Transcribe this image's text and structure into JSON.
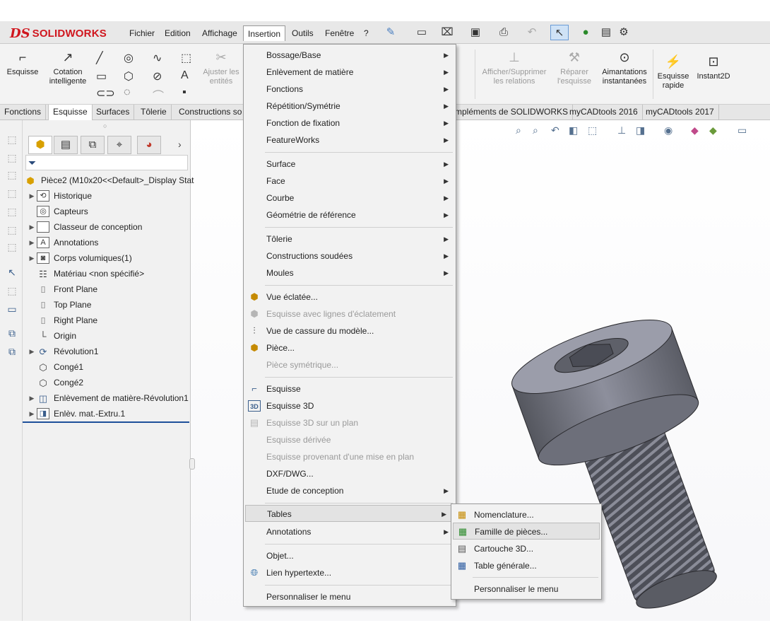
{
  "app": {
    "logo_prefix": "DS",
    "logo_text": "SOLIDWORKS"
  },
  "menubar": {
    "items": [
      "Fichier",
      "Edition",
      "Affichage",
      "Insertion",
      "Outils",
      "Fenêtre",
      "?"
    ]
  },
  "ribbon": {
    "esquisse": "Esquisse",
    "cotation": "Cotation intelligente",
    "ajuster": "Ajuster les entités",
    "afficher_relations": "Afficher/Supprimer les relations",
    "reparer": "Réparer l'esquisse",
    "aimantations": "Aimantations instantanées",
    "esquisse_rapide": "Esquisse rapide",
    "instant2d": "Instant2D"
  },
  "tabs": [
    "Fonctions",
    "Esquisse",
    "Surfaces",
    "Tôlerie",
    "Constructions so",
    "mpléments de SOLIDWORKS",
    "myCADtools 2016",
    "myCADtools 2017"
  ],
  "tree": {
    "root": "Pièce2  (M10x20<<Default>_Display Stat",
    "items": [
      "Historique",
      "Capteurs",
      "Classeur de conception",
      "Annotations",
      "Corps volumiques(1)",
      "Matériau <non spécifié>",
      "Front Plane",
      "Top Plane",
      "Right Plane",
      "Origin",
      "Révolution1",
      "Congé1",
      "Congé2",
      "Enlèvement de matière-Révolution1",
      "Enlèv. mat.-Extru.1"
    ]
  },
  "insert_menu": {
    "items": [
      "Bossage/Base",
      "Enlèvement de matière",
      "Fonctions",
      "Répétition/Symétrie",
      "Fonction de fixation",
      "FeatureWorks",
      "Surface",
      "Face",
      "Courbe",
      "Géométrie de référence",
      "Tôlerie",
      "Constructions soudées",
      "Moules",
      "Vue éclatée...",
      "Esquisse avec lignes d'éclatement",
      "Vue de cassure du modèle...",
      "Pièce...",
      "Pièce symétrique...",
      "Esquisse",
      "Esquisse 3D",
      "Esquisse 3D sur un plan",
      "Esquisse dérivée",
      "Esquisse provenant d'une mise en plan",
      "DXF/DWG...",
      "Etude de conception",
      "Tables",
      "Annotations",
      "Objet...",
      "Lien hypertexte...",
      "Personnaliser le menu"
    ]
  },
  "tables_submenu": {
    "items": [
      "Nomenclature...",
      "Famille de pièces...",
      "Cartouche 3D...",
      "Table générale...",
      "Personnaliser le menu"
    ]
  },
  "colors": {
    "brand": "#d0161e",
    "selection_bar": "#1e4f9a",
    "bolt": "#6e7080"
  }
}
